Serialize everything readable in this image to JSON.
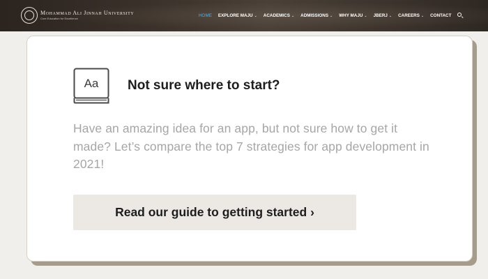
{
  "nav": {
    "brand": {
      "name": "Mohammad Ali Jinnah University",
      "subtitle": "Core Education for Excellence"
    },
    "items": [
      {
        "label": "HOME",
        "active": true,
        "dropdown": false
      },
      {
        "label": "EXPLORE MAJU",
        "active": false,
        "dropdown": true
      },
      {
        "label": "ACADEMICS",
        "active": false,
        "dropdown": true
      },
      {
        "label": "ADMISSIONS",
        "active": false,
        "dropdown": true
      },
      {
        "label": "WHY MAJU",
        "active": false,
        "dropdown": true
      },
      {
        "label": "JBERJ",
        "active": false,
        "dropdown": true
      },
      {
        "label": "CAREERS",
        "active": false,
        "dropdown": true
      },
      {
        "label": "CONTACT",
        "active": false,
        "dropdown": false
      }
    ],
    "caret_glyph": "⌄",
    "active_color": "#43b5f0",
    "search_icon": "search-icon"
  },
  "card": {
    "icon_text": "Aa",
    "icon": "book-icon",
    "title": "Not sure where to start?",
    "body": "Have an amazing idea for an app, but not sure how to get it made? Let’s compare the top 7 strategies for app development in 2021!",
    "button_label": "Read our guide to getting started ›",
    "shadow_color": "#a69c8b"
  }
}
